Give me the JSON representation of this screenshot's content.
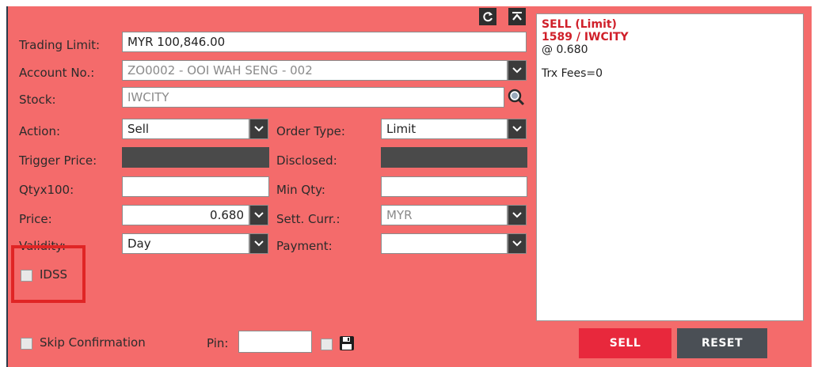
{
  "toolbar": {
    "refresh_icon": "refresh-icon",
    "collapse_icon": "collapse-up-icon"
  },
  "form": {
    "trading_limit_label": "Trading Limit:",
    "trading_limit_value": "MYR 100,846.00",
    "account_label": "Account No.:",
    "account_value": "ZO0002 - OOI WAH SENG - 002",
    "stock_label": "Stock:",
    "stock_value": "IWCITY",
    "action_label": "Action:",
    "action_value": "Sell",
    "order_type_label": "Order Type:",
    "order_type_value": "Limit",
    "trigger_price_label": "Trigger Price:",
    "disclosed_label": "Disclosed:",
    "qty_label": "Qtyx100:",
    "qty_value": "",
    "min_qty_label": "Min Qty:",
    "min_qty_value": "",
    "price_label": "Price:",
    "price_value": "0.680",
    "sett_curr_label": "Sett. Curr.:",
    "sett_curr_value": "MYR",
    "validity_label": "Validity:",
    "validity_value": "Day",
    "payment_label": "Payment:",
    "payment_value": "",
    "idss_label": "IDSS",
    "skip_confirmation_label": "Skip Confirmation",
    "pin_label": "Pin:",
    "pin_value": ""
  },
  "summary": {
    "line1": "SELL (Limit)",
    "line2": "1589 / IWCITY",
    "line3": "@ 0.680",
    "line4": "Trx Fees=0"
  },
  "buttons": {
    "sell": "SELL",
    "reset": "RESET"
  },
  "colors": {
    "panel_bg": "#f46b6b",
    "sell_button": "#e8283c",
    "reset_button": "#4a4f55",
    "summary_red": "#d0202a",
    "highlight_box": "#e02525"
  }
}
